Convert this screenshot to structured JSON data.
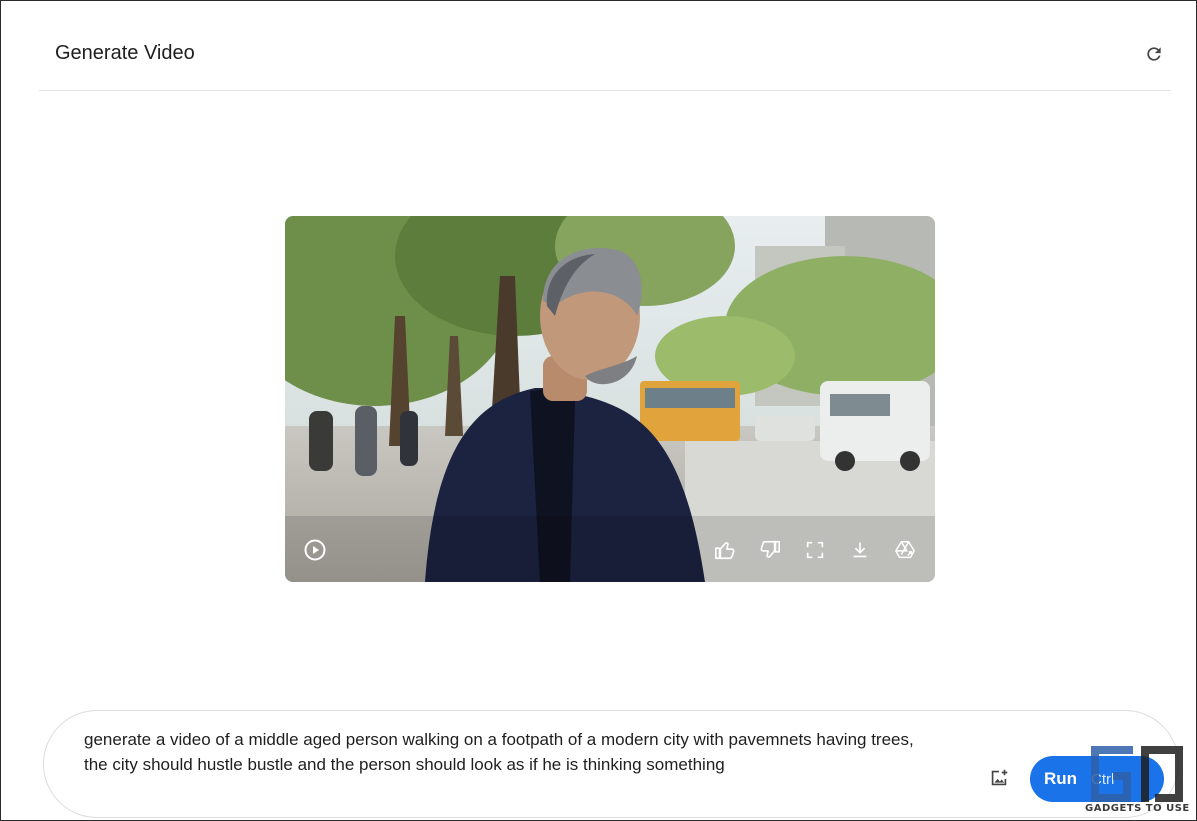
{
  "header": {
    "title": "Generate Video"
  },
  "icons": {
    "refresh": "refresh-icon",
    "play": "play-icon",
    "thumbs_up": "thumbs-up-icon",
    "thumbs_down": "thumbs-down-icon",
    "fullscreen": "fullscreen-icon",
    "download": "download-icon",
    "drive": "drive-icon",
    "upload_image": "add-image-icon"
  },
  "prompt": {
    "text": "generate a video of a middle aged person walking on a footpath of a modern city with pavemnets having trees,\nthe city should hustle bustle and the person should look as if he is thinking something"
  },
  "run_button": {
    "label": "Run",
    "shortcut": "Ctrl"
  },
  "watermark": {
    "text": "GADGETS TO USE"
  },
  "colors": {
    "accent": "#1a73e8"
  }
}
